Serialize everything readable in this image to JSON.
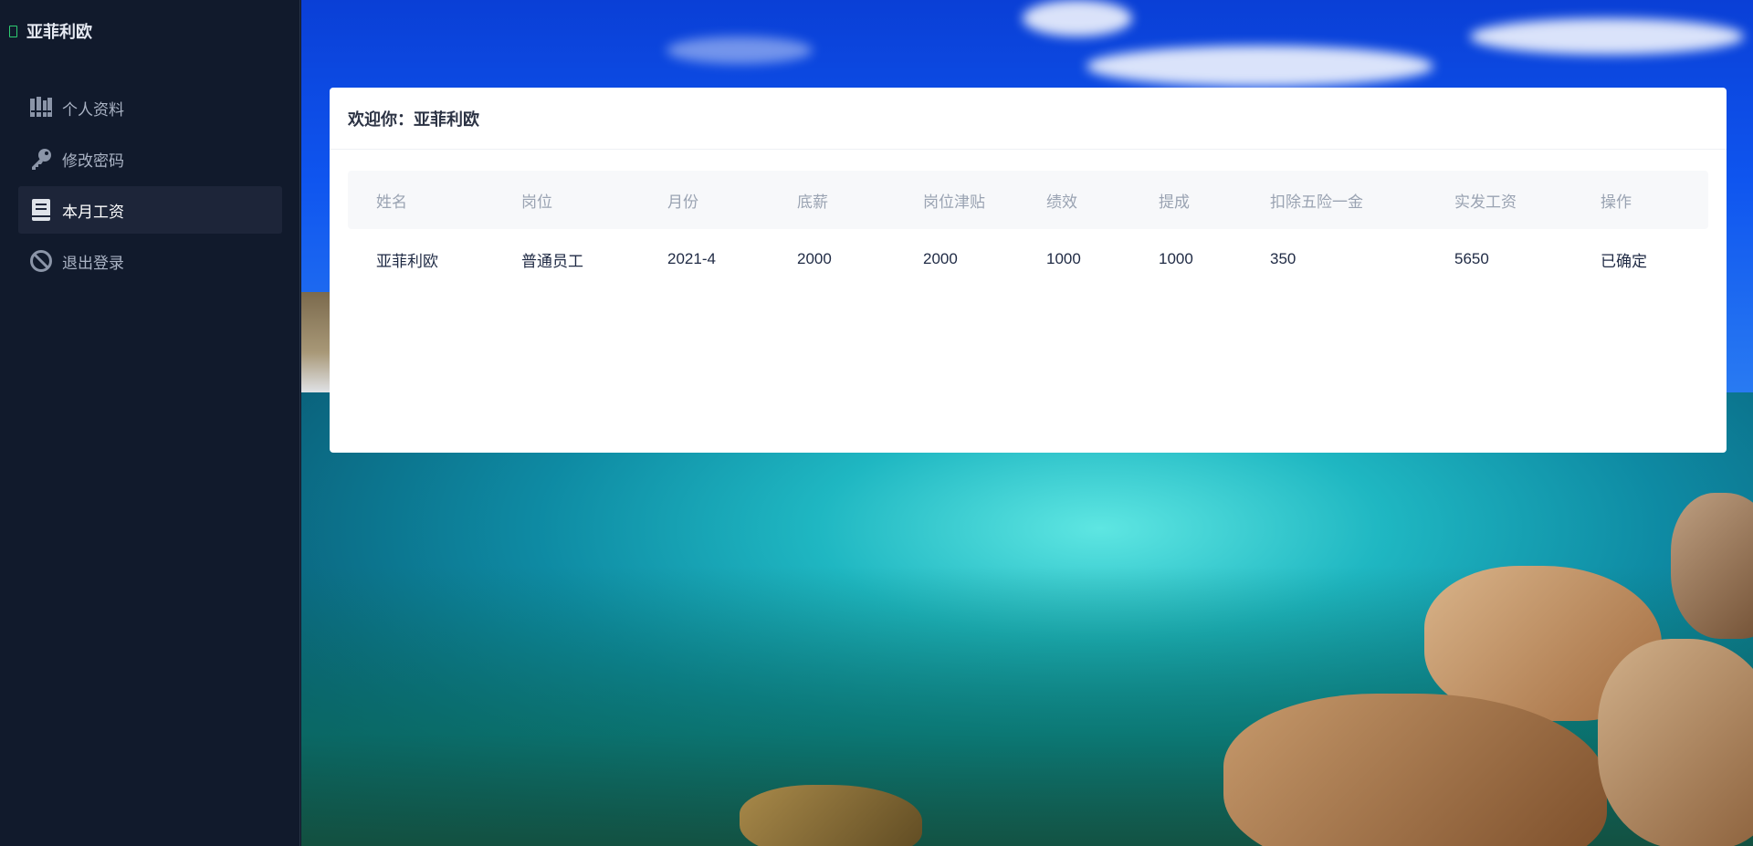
{
  "sidebar": {
    "brand": "亚菲利欧",
    "items": [
      {
        "label": "个人资料",
        "icon": "id-card-icon",
        "active": false
      },
      {
        "label": "修改密码",
        "icon": "key-icon",
        "active": false
      },
      {
        "label": "本月工资",
        "icon": "book-icon",
        "active": true
      },
      {
        "label": "退出登录",
        "icon": "ban-icon",
        "active": false
      }
    ]
  },
  "card": {
    "title": "欢迎你：亚菲利欧"
  },
  "table": {
    "columns": [
      "姓名",
      "岗位",
      "月份",
      "底薪",
      "岗位津贴",
      "绩效",
      "提成",
      "扣除五险一金",
      "实发工资",
      "操作"
    ],
    "rows": [
      [
        "亚菲利欧",
        "普通员工",
        "2021-4",
        "2000",
        "2000",
        "1000",
        "1000",
        "350",
        "5650",
        "已确定"
      ]
    ]
  },
  "colors": {
    "sidebar_bg": "#111a2c",
    "active_item_bg": "#1d2539",
    "brand_mark": "#2ecc71"
  }
}
